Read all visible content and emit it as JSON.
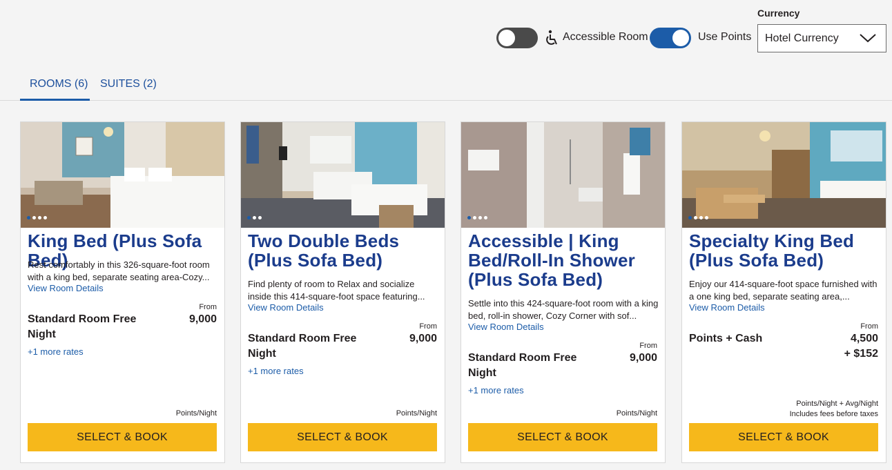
{
  "filters": {
    "accessible_label": "Accessible Room",
    "accessible_on": false,
    "points_label": "Use Points",
    "points_on": true,
    "currency_label": "Currency",
    "currency_value": "Hotel Currency"
  },
  "tabs": [
    {
      "label": "ROOMS (6)",
      "active": true
    },
    {
      "label": "SUITES (2)",
      "active": false
    }
  ],
  "colors": {
    "accent": "#1c5ca8",
    "title": "#1b3c8c",
    "button": "#f6b81b"
  },
  "cards": [
    {
      "title": "King Bed (Plus Sofa Bed)",
      "description": "Rest comfortably in this 326-square-foot room with a king bed, separate seating area-Cozy...",
      "details_link": "View Room Details",
      "rate_name": "Standard Room Free Night",
      "from_label": "From",
      "price": "9,000",
      "more_rates": "+1 more rates",
      "unit": "Points/Night",
      "button": "SELECT & BOOK"
    },
    {
      "title": "Two Double Beds (Plus Sofa Bed)",
      "description": "Find plenty of room to Relax and socialize inside this 414-square-foot space featuring...",
      "details_link": "View Room Details",
      "rate_name": "Standard Room Free Night",
      "from_label": "From",
      "price": "9,000",
      "more_rates": "+1 more rates",
      "unit": "Points/Night",
      "button": "SELECT & BOOK"
    },
    {
      "title": "Accessible | King Bed/Roll-In Shower (Plus Sofa Bed)",
      "description": "Settle into this 424-square-foot room with a king bed, roll-in shower, Cozy Corner with sof...",
      "details_link": "View Room Details",
      "rate_name": "Standard Room Free Night",
      "from_label": "From",
      "price": "9,000",
      "more_rates": "+1 more rates",
      "unit": "Points/Night",
      "button": "SELECT & BOOK"
    },
    {
      "title": "Specialty King Bed (Plus Sofa Bed)",
      "description": "Enjoy our 414-square-foot space furnished with a one king bed, separate seating area,...",
      "details_link": "View Room Details",
      "rate_name": "Points + Cash",
      "from_label": "From",
      "price": "4,500",
      "price_cash": "+ $152",
      "unit_line1": "Points/Night + Avg/Night",
      "unit_line2": "Includes fees before taxes",
      "button": "SELECT & BOOK"
    }
  ]
}
